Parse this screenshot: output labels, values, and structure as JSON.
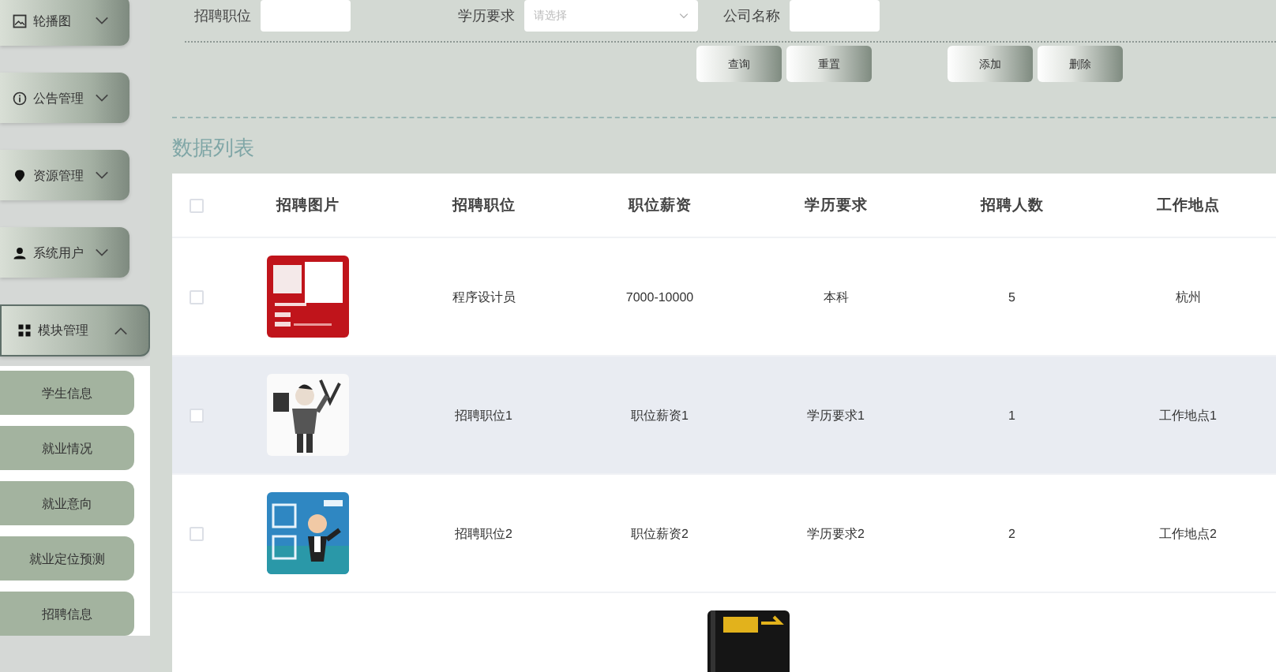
{
  "sidebar": {
    "menus": [
      {
        "label": "轮播图",
        "expanded": false
      },
      {
        "label": "公告管理",
        "expanded": false
      },
      {
        "label": "资源管理",
        "expanded": false
      },
      {
        "label": "系统用户",
        "expanded": false
      },
      {
        "label": "模块管理",
        "expanded": true,
        "children": [
          {
            "label": "学生信息"
          },
          {
            "label": "就业情况"
          },
          {
            "label": "就业意向"
          },
          {
            "label": "就业定位预测"
          },
          {
            "label": "招聘信息"
          }
        ]
      }
    ]
  },
  "filters": [
    {
      "label": "招聘职位",
      "kind": "input"
    },
    {
      "label": "学历要求",
      "kind": "select",
      "placeholder": "请选择"
    },
    {
      "label": "公司名称",
      "kind": "input"
    }
  ],
  "actions": [
    {
      "label": "查询"
    },
    {
      "label": "重置"
    },
    {
      "label": "添加"
    },
    {
      "label": "删除"
    }
  ],
  "list_title": "数据列表",
  "table": {
    "header_checked": false,
    "columns": [
      "招聘图片",
      "招聘职位",
      "职位薪资",
      "学历要求",
      "招聘人数",
      "工作地点"
    ],
    "rows": [
      {
        "checked": false,
        "highlighted": false,
        "image": {
          "kind": "picture"
        },
        "cells": [
          "程序设计员",
          "7000-10000",
          "本科",
          "5",
          "杭州"
        ]
      },
      {
        "checked": false,
        "highlighted": true,
        "image": {
          "kind": "picture"
        },
        "cells": [
          "招聘职位1",
          "职位薪资1",
          "学历要求1",
          "1",
          "工作地点1"
        ]
      },
      {
        "checked": false,
        "highlighted": false,
        "image": {
          "kind": "picture"
        },
        "cells": [
          "招聘职位2",
          "职位薪资2",
          "学历要求2",
          "2",
          "工作地点2"
        ]
      },
      {
        "image": {
          "kind": "picture"
        }
      }
    ]
  }
}
